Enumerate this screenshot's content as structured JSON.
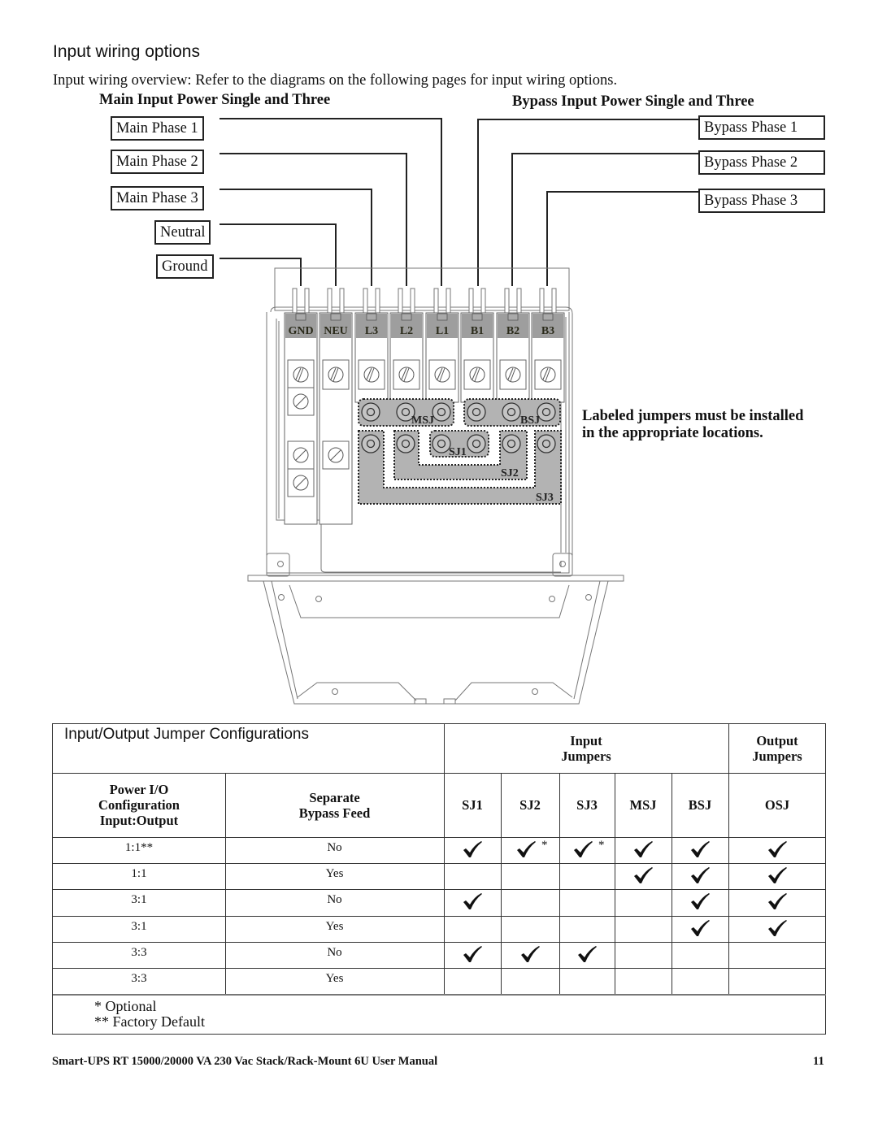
{
  "page": {
    "section_title": "Input wiring options",
    "intro": "Input wiring overview: Refer to the diagrams on the following pages for input wiring options.",
    "main_group_title": "Main Input Power Single and Three",
    "bypass_group_title": "Bypass Input Power Single and Three",
    "main_labels": [
      "Main Phase 1",
      "Main Phase 2",
      "Main Phase 3",
      "Neutral",
      "Ground"
    ],
    "bypass_labels": [
      "Bypass Phase 1",
      "Bypass Phase 2",
      "Bypass Phase 3"
    ],
    "terminals": [
      "GND",
      "NEU",
      "L3",
      "L2",
      "L1",
      "B1",
      "B2",
      "B3"
    ],
    "jumpers": [
      "MSJ",
      "BSJ",
      "SJ1",
      "SJ2",
      "SJ3"
    ],
    "jumper_note": "Labeled jumpers must be installed in the appropriate locations.",
    "footer": "Smart-UPS RT 15000/20000 VA  230 Vac  Stack/Rack-Mount 6U  User Manual",
    "page_number": "11"
  },
  "table": {
    "title": "Input/Output Jumper Configurations",
    "input_group": "Input\nJumpers",
    "input_group_l1": "Input",
    "input_group_l2": "Jumpers",
    "output_group_l1": "Output",
    "output_group_l2": "Jumpers",
    "col_config": [
      "Power I/O",
      "Configuration",
      "Input:Output"
    ],
    "col_bypass": [
      "Separate",
      "Bypass Feed"
    ],
    "jumper_cols": [
      "SJ1",
      "SJ2",
      "SJ3",
      "MSJ",
      "BSJ",
      "OSJ"
    ],
    "rows": [
      {
        "config": "1:1**",
        "bypass": "No",
        "checks": [
          true,
          true,
          true,
          true,
          true,
          true
        ],
        "optional": [
          false,
          true,
          true,
          false,
          false,
          false
        ]
      },
      {
        "config": "1:1",
        "bypass": "Yes",
        "checks": [
          false,
          false,
          false,
          true,
          true,
          true
        ],
        "optional": [
          false,
          false,
          false,
          false,
          false,
          false
        ]
      },
      {
        "config": "3:1",
        "bypass": "No",
        "checks": [
          true,
          false,
          false,
          false,
          true,
          true
        ],
        "optional": [
          false,
          false,
          false,
          false,
          false,
          false
        ]
      },
      {
        "config": "3:1",
        "bypass": "Yes",
        "checks": [
          false,
          false,
          false,
          false,
          true,
          true
        ],
        "optional": [
          false,
          false,
          false,
          false,
          false,
          false
        ]
      },
      {
        "config": "3:3",
        "bypass": "No",
        "checks": [
          true,
          true,
          true,
          false,
          false,
          false
        ],
        "optional": [
          false,
          false,
          false,
          false,
          false,
          false
        ]
      },
      {
        "config": "3:3",
        "bypass": "Yes",
        "checks": [
          false,
          false,
          false,
          false,
          false,
          false
        ],
        "optional": [
          false,
          false,
          false,
          false,
          false,
          false
        ]
      }
    ],
    "optional_mark": "*",
    "notes": [
      "* Optional",
      "** Factory Default"
    ]
  }
}
